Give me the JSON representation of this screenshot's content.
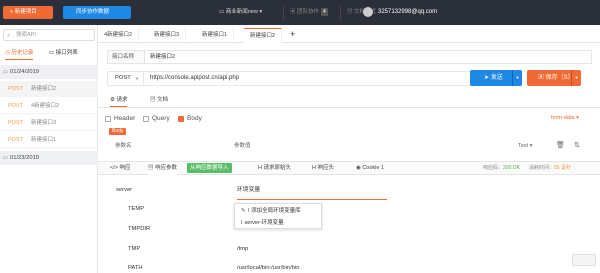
{
  "topbar": {
    "new_button": "新建项目",
    "sync_button": "同步协作数据",
    "env_select": "商业新闻new",
    "team_label": "团队协作",
    "team_badge": "4",
    "doc_mode": "文档模式",
    "user_email": "3257132998@qq.com"
  },
  "sidebar": {
    "search_placeholder": "搜索API",
    "tabs": [
      {
        "label": "历史记录"
      },
      {
        "label": "接口列表"
      }
    ],
    "groups": [
      {
        "date": "01/24/2019",
        "items": [
          {
            "method": "POST",
            "name": "新建接口2"
          },
          {
            "method": "POST",
            "name": "4新建接口2"
          },
          {
            "method": "POST",
            "name": "新建接口3"
          },
          {
            "method": "POST",
            "name": "新建接口1"
          }
        ]
      },
      {
        "date": "01/23/2019",
        "items": []
      }
    ]
  },
  "main": {
    "tabs": [
      {
        "label": "4新建接口2"
      },
      {
        "label": "新建接口3"
      },
      {
        "label": "新建接口1"
      },
      {
        "label": "新建接口2"
      }
    ],
    "name_label": "接口名称",
    "name_value": "新建接口2",
    "method": "POST",
    "url": "https://console.apipost.cn/api.php",
    "send_label": "发送",
    "save_label": "保存（S）",
    "sub_tabs": [
      {
        "label": "请求"
      },
      {
        "label": "文档"
      }
    ],
    "body_types": [
      {
        "label": "Header"
      },
      {
        "label": "Query"
      },
      {
        "label": "Body"
      }
    ],
    "form_type": "form-data",
    "body_badge": "Body",
    "param_header": {
      "name": "参数名",
      "value": "参数值",
      "type": "Text"
    },
    "resp_tabs": [
      {
        "label": "响应"
      },
      {
        "label": "响应参数"
      },
      {
        "label": "请求原始头"
      },
      {
        "label": "响应头"
      },
      {
        "label": "Cookie"
      }
    ],
    "resp_tag": "从响应数据导入",
    "resp_tab_cookie_count": "1",
    "status_label": "响应码：",
    "status_value": "200 OK",
    "time_label": "消耗时间：",
    "time_value": "85 毫秒",
    "env_rows": [
      {
        "key": "server",
        "value": "环境变量"
      },
      {
        "key": "TEMP",
        "value": ""
      },
      {
        "key": "TMPDIR",
        "value": ""
      },
      {
        "key": "TMP",
        "value": "/tmp"
      },
      {
        "key": "PATH",
        "value": "/usr/local/bin:/usr/bin/bin"
      }
    ],
    "popup": [
      {
        "label": "添加全局环境变量库"
      },
      {
        "label": "server-环境变量"
      }
    ]
  },
  "colors": {
    "accent": "#f06a35",
    "primary": "#1e88e5",
    "success": "#5bbd6a",
    "topbar": "#2b2f3a"
  }
}
